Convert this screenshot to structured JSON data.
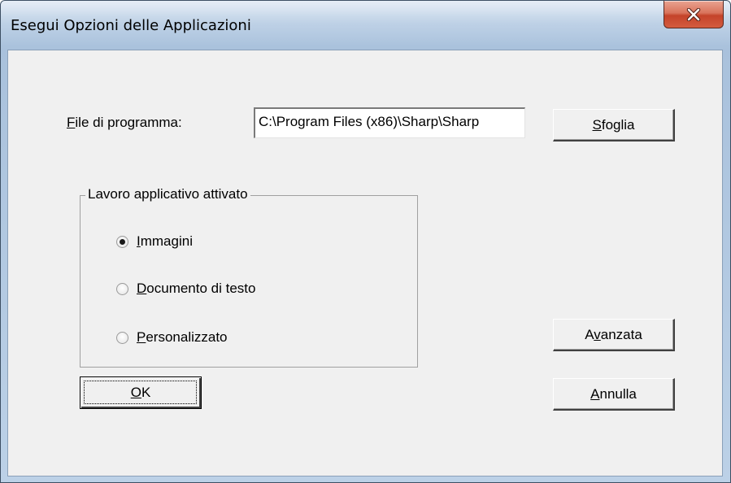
{
  "window": {
    "title": "Esegui Opzioni delle Applicazioni",
    "close_label": "X"
  },
  "program_file": {
    "label_accel": "F",
    "label_rest": "ile di programma:",
    "value": "C:\\Program Files (x86)\\Sharp\\Sharp"
  },
  "buttons": {
    "browse": {
      "accel": "S",
      "rest": "foglia"
    },
    "advanced": {
      "pre": "A",
      "accel": "v",
      "rest": "anzata"
    },
    "ok": {
      "accel": "O",
      "rest": "K"
    },
    "cancel": {
      "accel": "A",
      "rest": "nnulla"
    }
  },
  "group": {
    "title": "Lavoro applicativo attivato",
    "options": [
      {
        "accel": "I",
        "rest": "mmagini",
        "selected": true
      },
      {
        "accel": "D",
        "rest": "ocumento di testo",
        "selected": false
      },
      {
        "accel": "P",
        "rest": "ersonalizzato",
        "selected": false
      }
    ]
  },
  "colors": {
    "dialog_bg": "#f0f0f0",
    "close_button": "#c4432a",
    "frame": "#b5cbe3"
  }
}
